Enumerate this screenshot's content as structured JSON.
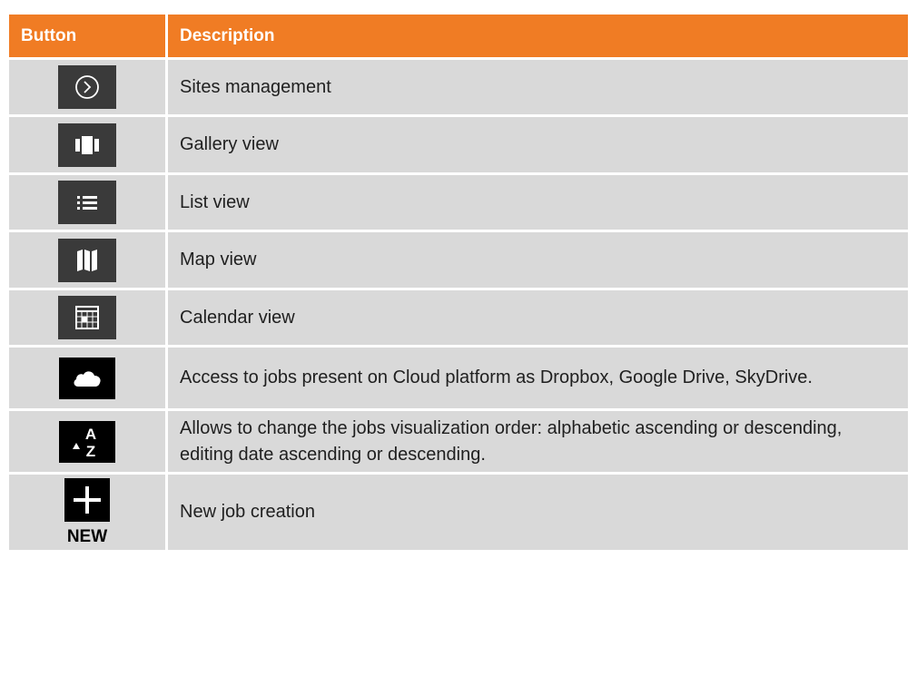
{
  "header": {
    "col_button": "Button",
    "col_description": "Description"
  },
  "rows": [
    {
      "icon": "chevron-circle-right-icon",
      "description": "Sites management"
    },
    {
      "icon": "gallery-icon",
      "description": "Gallery view"
    },
    {
      "icon": "list-icon",
      "description": "List view"
    },
    {
      "icon": "map-icon",
      "description": "Map view"
    },
    {
      "icon": "calendar-icon",
      "description": "Calendar view"
    },
    {
      "icon": "cloud-icon",
      "description": "Access to jobs present on Cloud platform as Dropbox, Google Drive, SkyDrive."
    },
    {
      "icon": "sort-az-icon",
      "description": "Allows to change the jobs visualization order: alphabetic ascending or descending, editing date ascending or descending.",
      "icon_text_a": "A",
      "icon_text_z": "Z"
    },
    {
      "icon": "plus-icon",
      "description": "New job creation",
      "icon_label": "NEW"
    }
  ],
  "colors": {
    "header_bg": "#f07c24",
    "row_bg": "#d9d9d9",
    "icon_bg": "#3a3a3a"
  }
}
